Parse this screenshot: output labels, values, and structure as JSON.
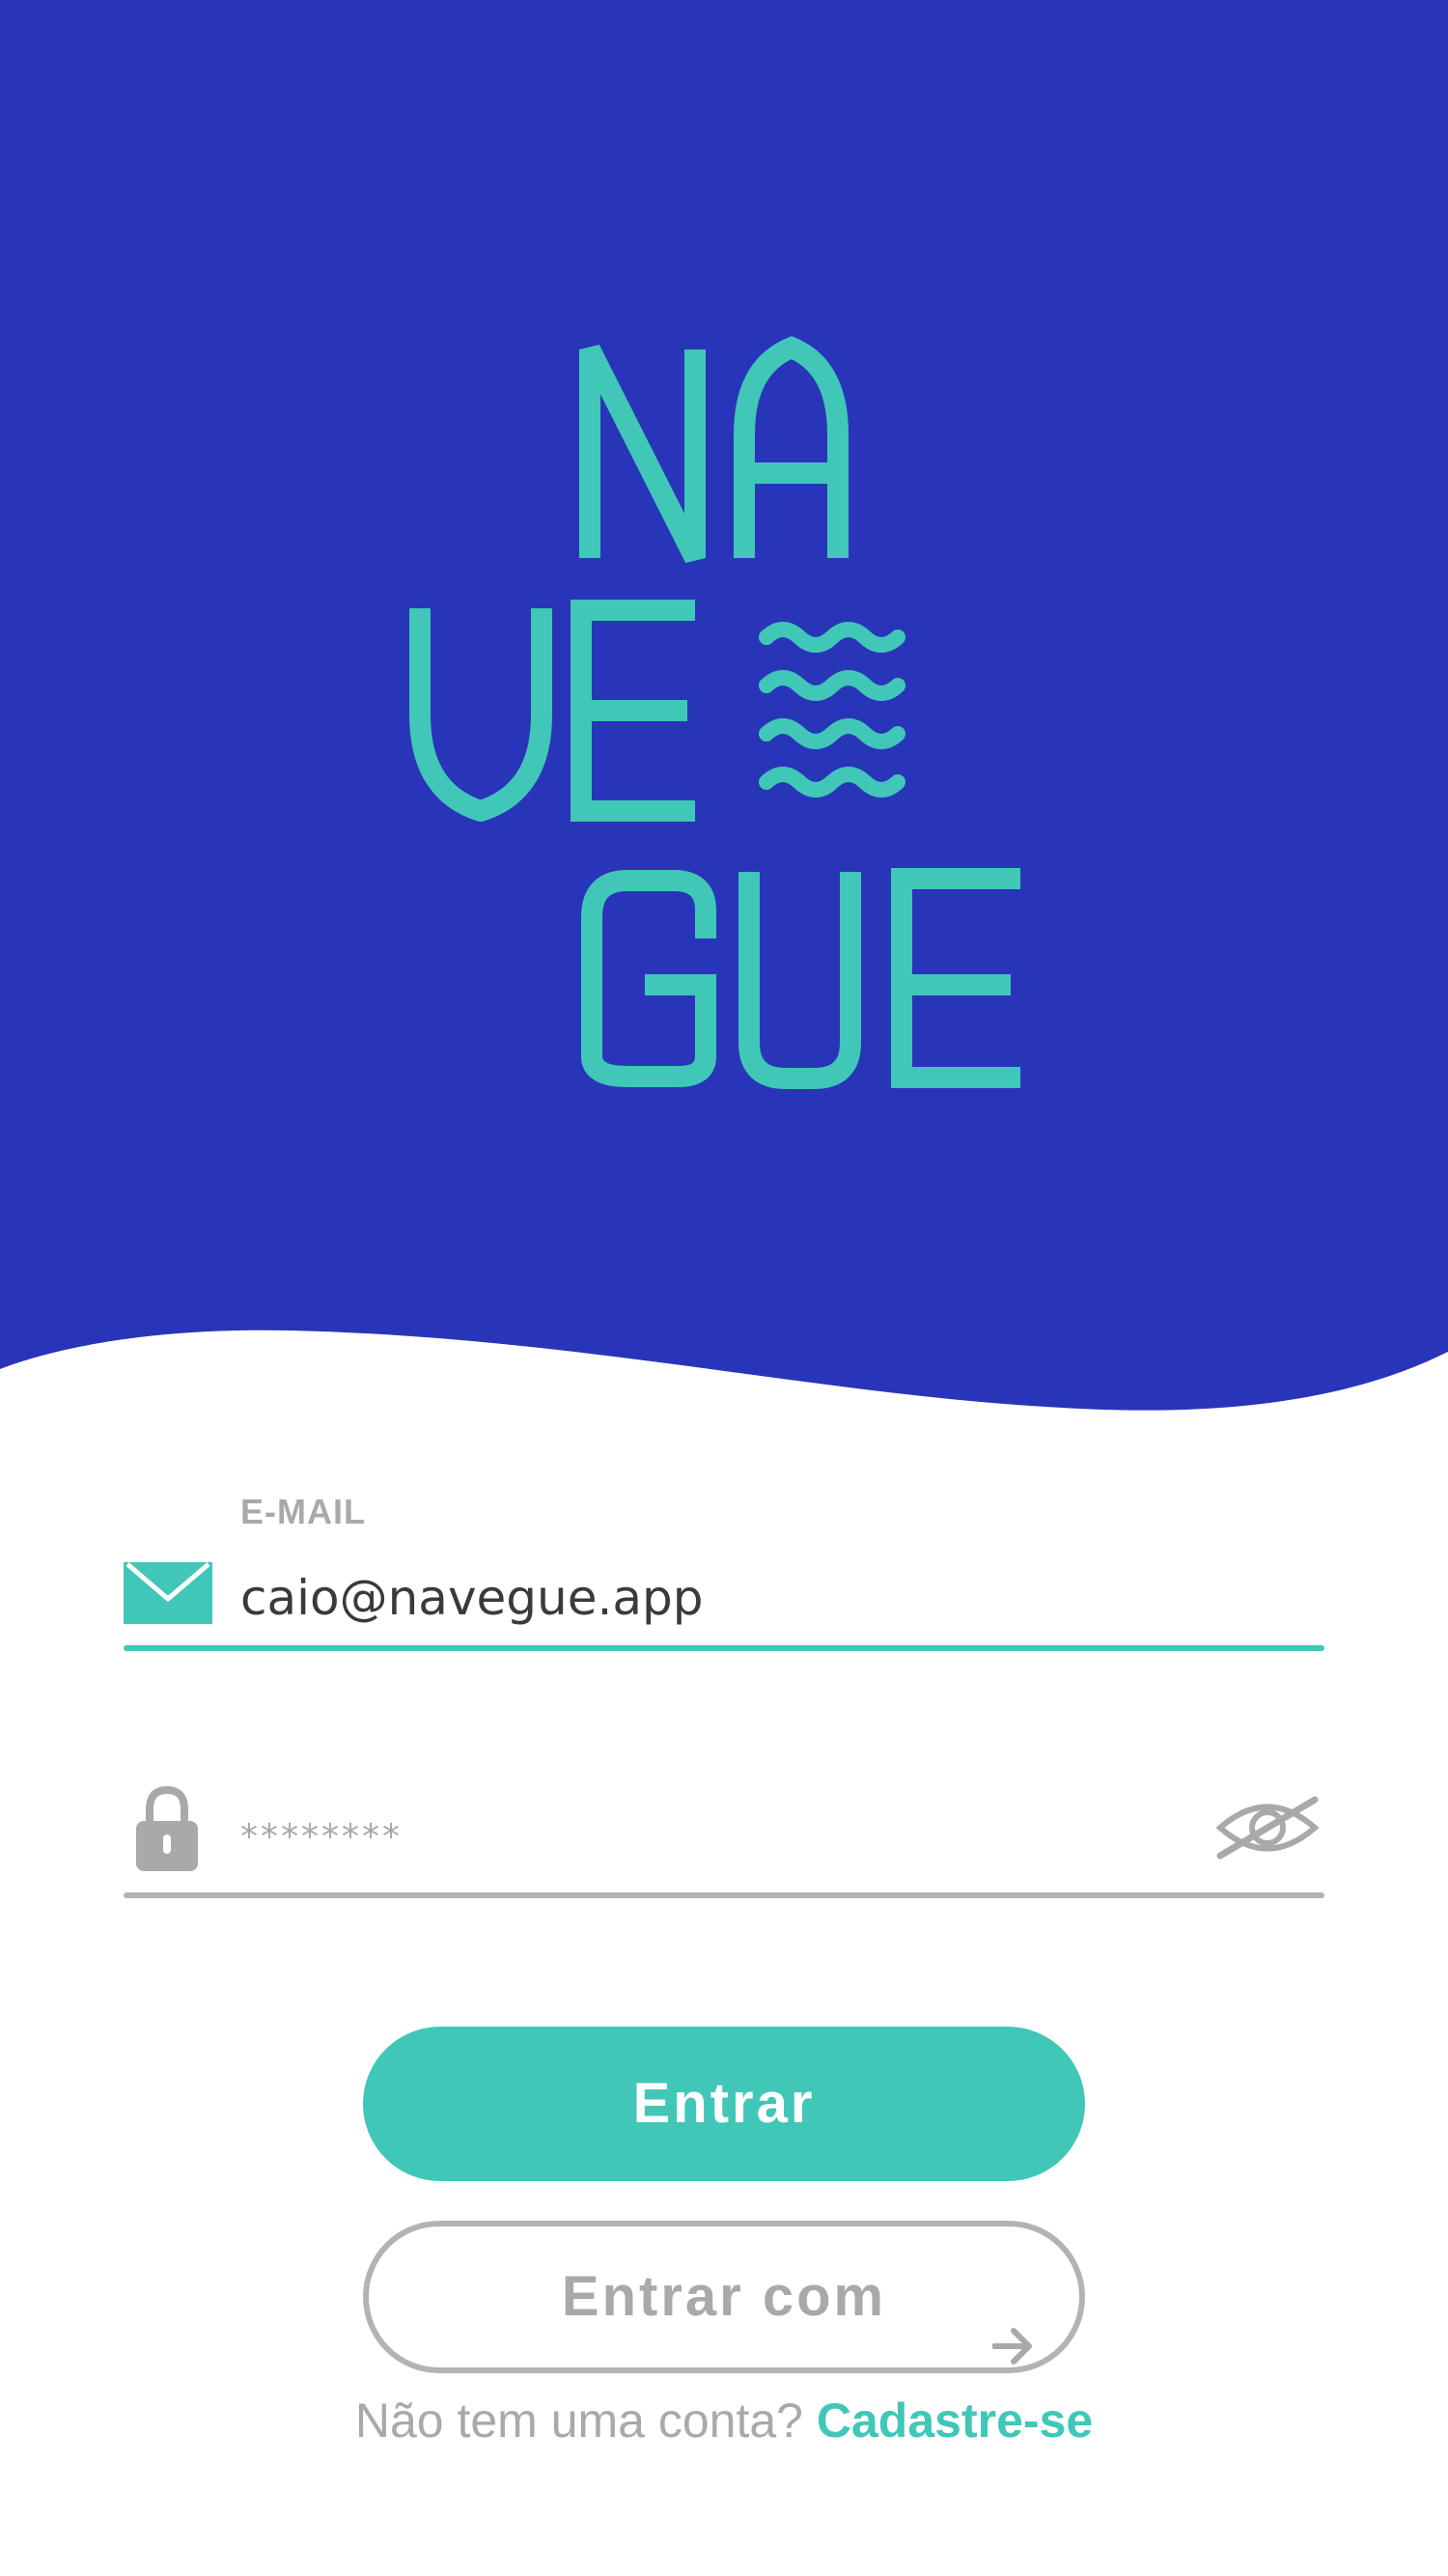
{
  "colors": {
    "brand_blue": "#2935b8",
    "accent_teal": "#40c7b8",
    "muted_gray": "#a9a9a9",
    "text_dark": "#3a3a3a"
  },
  "logo": {
    "line1": "NA",
    "line2": "VE",
    "line3": "GUE",
    "waves_icon": "waves-icon"
  },
  "email": {
    "label": "E-MAIL",
    "value": "caio@navegue.app",
    "icon": "envelope-icon"
  },
  "password": {
    "placeholder": "********",
    "icon": "lock-icon",
    "toggle_icon": "eye-off-icon"
  },
  "buttons": {
    "login": "Entrar",
    "login_with": "Entrar com",
    "login_with_icon": "arrow-right-icon"
  },
  "signup": {
    "prompt": "Não tem uma conta?",
    "link": "Cadastre-se"
  }
}
